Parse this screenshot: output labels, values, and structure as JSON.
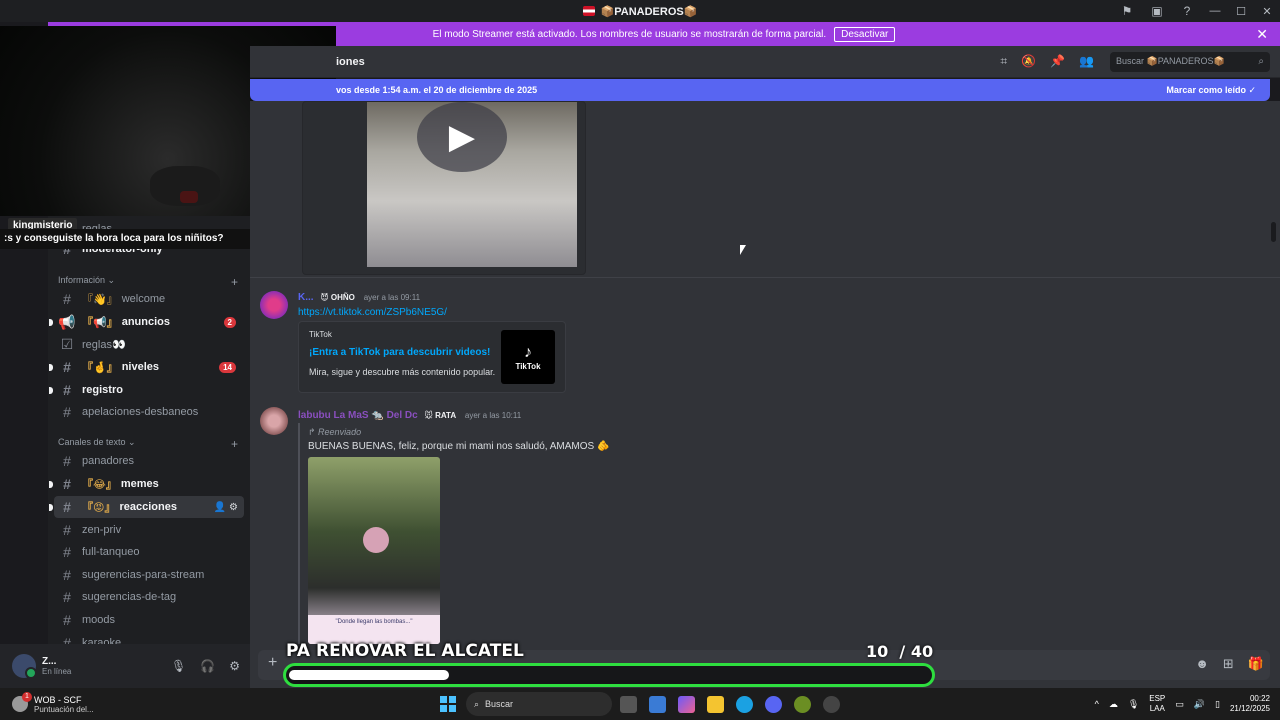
{
  "window": {
    "title": "📦PANADEROS📦"
  },
  "banner": {
    "text": "El modo Streamer está activado. Los nombres de usuario se mostrarán de forma parcial.",
    "button": "Desactivar"
  },
  "overlay_chat": {
    "username": "kingmisterio",
    "message": ":s y conseguiste la hora loca para los niñitos?"
  },
  "sidebar": {
    "hidden_items": [
      {
        "label": "reglas"
      },
      {
        "label": "moderator-only"
      }
    ],
    "categories": {
      "info": "Información",
      "text": "Canales de texto"
    },
    "info_channels": [
      {
        "label": "welcome",
        "prefix": "『👋』",
        "unread": false
      },
      {
        "label": "anuncios",
        "prefix": "『📢』",
        "unread": true,
        "badge": "2"
      },
      {
        "label": "reglas👀",
        "prefix": "",
        "unread": false
      },
      {
        "label": "niveles",
        "prefix": "『🤞』",
        "unread": true,
        "badge": "14"
      },
      {
        "label": "registro",
        "prefix": "",
        "unread": true
      },
      {
        "label": "apelaciones-desbaneos",
        "prefix": "",
        "unread": false
      }
    ],
    "text_channels": [
      {
        "label": "panadores",
        "prefix": "",
        "unread": false
      },
      {
        "label": "memes",
        "prefix": "『😂』",
        "unread": true
      },
      {
        "label": "reacciones",
        "prefix": "『😡』",
        "unread": true,
        "active": true
      },
      {
        "label": "zen-priv",
        "prefix": "",
        "unread": false
      },
      {
        "label": "full-tanqueo",
        "prefix": "",
        "unread": false
      },
      {
        "label": "sugerencias-para-stream",
        "prefix": "",
        "unread": false
      },
      {
        "label": "sugerencias-de-tag",
        "prefix": "",
        "unread": false
      },
      {
        "label": "moods",
        "prefix": "",
        "unread": false
      },
      {
        "label": "karaoke",
        "prefix": "",
        "unread": false
      }
    ]
  },
  "user_panel": {
    "name": "Z...",
    "status": "En línea"
  },
  "channel_header": {
    "title": "iones",
    "search_placeholder": "Buscar 📦PANADEROS📦"
  },
  "new_messages_bar": {
    "text": "vos desde 1:54 a.m. el 20 de diciembre de 2025",
    "action": "Marcar como leído"
  },
  "messages": [
    {
      "user": "K...",
      "role": "OHÑO",
      "time": "ayer a las 09:11",
      "link": "https://vt.tiktok.com/ZSPb6NE5G/",
      "embed": {
        "provider": "TikTok",
        "title": "¡Entra a TikTok para descubrir videos!",
        "description": "Mira, sigue y descubre más contenido popular.",
        "thumb_label": "TikTok"
      }
    },
    {
      "user": "labubu La MaS",
      "user_suffix": "Del Dc",
      "role": "RATA",
      "time": "ayer a las 10:11",
      "forward_label": "Reenviado",
      "text": "BUENAS BUENAS, feliz, porque mi mami nos saludó, AMAMOS",
      "media_caption": "\"Donde llegan las bombas...\""
    }
  ],
  "stream_overlay": {
    "goal_title": "PA RENOVAR EL ALCATEL",
    "current": "10",
    "target": "/ 40",
    "progress_fraction": 0.25
  },
  "taskbar": {
    "weather_title": "WOB - SCF",
    "weather_sub": "Puntuación del...",
    "search": "Buscar",
    "lang_top": "ESP",
    "lang_bottom": "LAA",
    "time": "00:22",
    "date": "21/12/2025"
  },
  "colors": {
    "streamer_banner": "#9b3ce0",
    "new_bar": "#5865f2",
    "progress_border": "#2ede3f",
    "badge": "#da373c",
    "link": "#00a8fc"
  }
}
